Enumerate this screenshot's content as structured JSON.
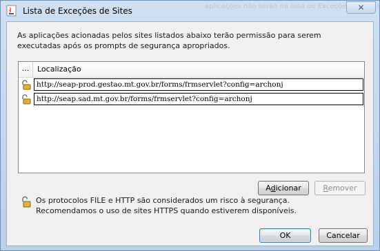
{
  "window": {
    "title": "Lista de Exceções de Sites",
    "close_glyph": "✕",
    "background_ghost_text": "aplicações não serão na lista de Exceções de Sites"
  },
  "intro_text": "As aplicações acionadas pelos sites listados abaixo terão permissão para serem executadas após os prompts de segurança apropriados.",
  "table": {
    "columns": [
      "...",
      "Localização"
    ],
    "rows": [
      {
        "icon": "open-padlock-icon",
        "url": "http://seap-prod.gestao.mt.gov.br/forms/frmservlet?config=archonj"
      },
      {
        "icon": "open-padlock-icon",
        "url": "http://seap.sad.mt.gov.br/forms/frmservlet?config=archonj"
      }
    ]
  },
  "buttons": {
    "add": {
      "prefix": "A",
      "underline": "d",
      "rest": "icionar"
    },
    "remove": {
      "prefix": "",
      "underline": "R",
      "rest": "emover"
    },
    "ok": "OK",
    "cancel": "Cancelar"
  },
  "warning": {
    "icon": "open-padlock-icon",
    "line1": "Os protocolos FILE e HTTP são considerados um risco à segurança.",
    "line2": "Recomendamos o uso de sites HTTPS quando estiverem disponíveis."
  },
  "colors": {
    "title_bar": "#c9dcef",
    "client_background": "#f0f0f0",
    "padlock_gold": "#d9a520"
  }
}
